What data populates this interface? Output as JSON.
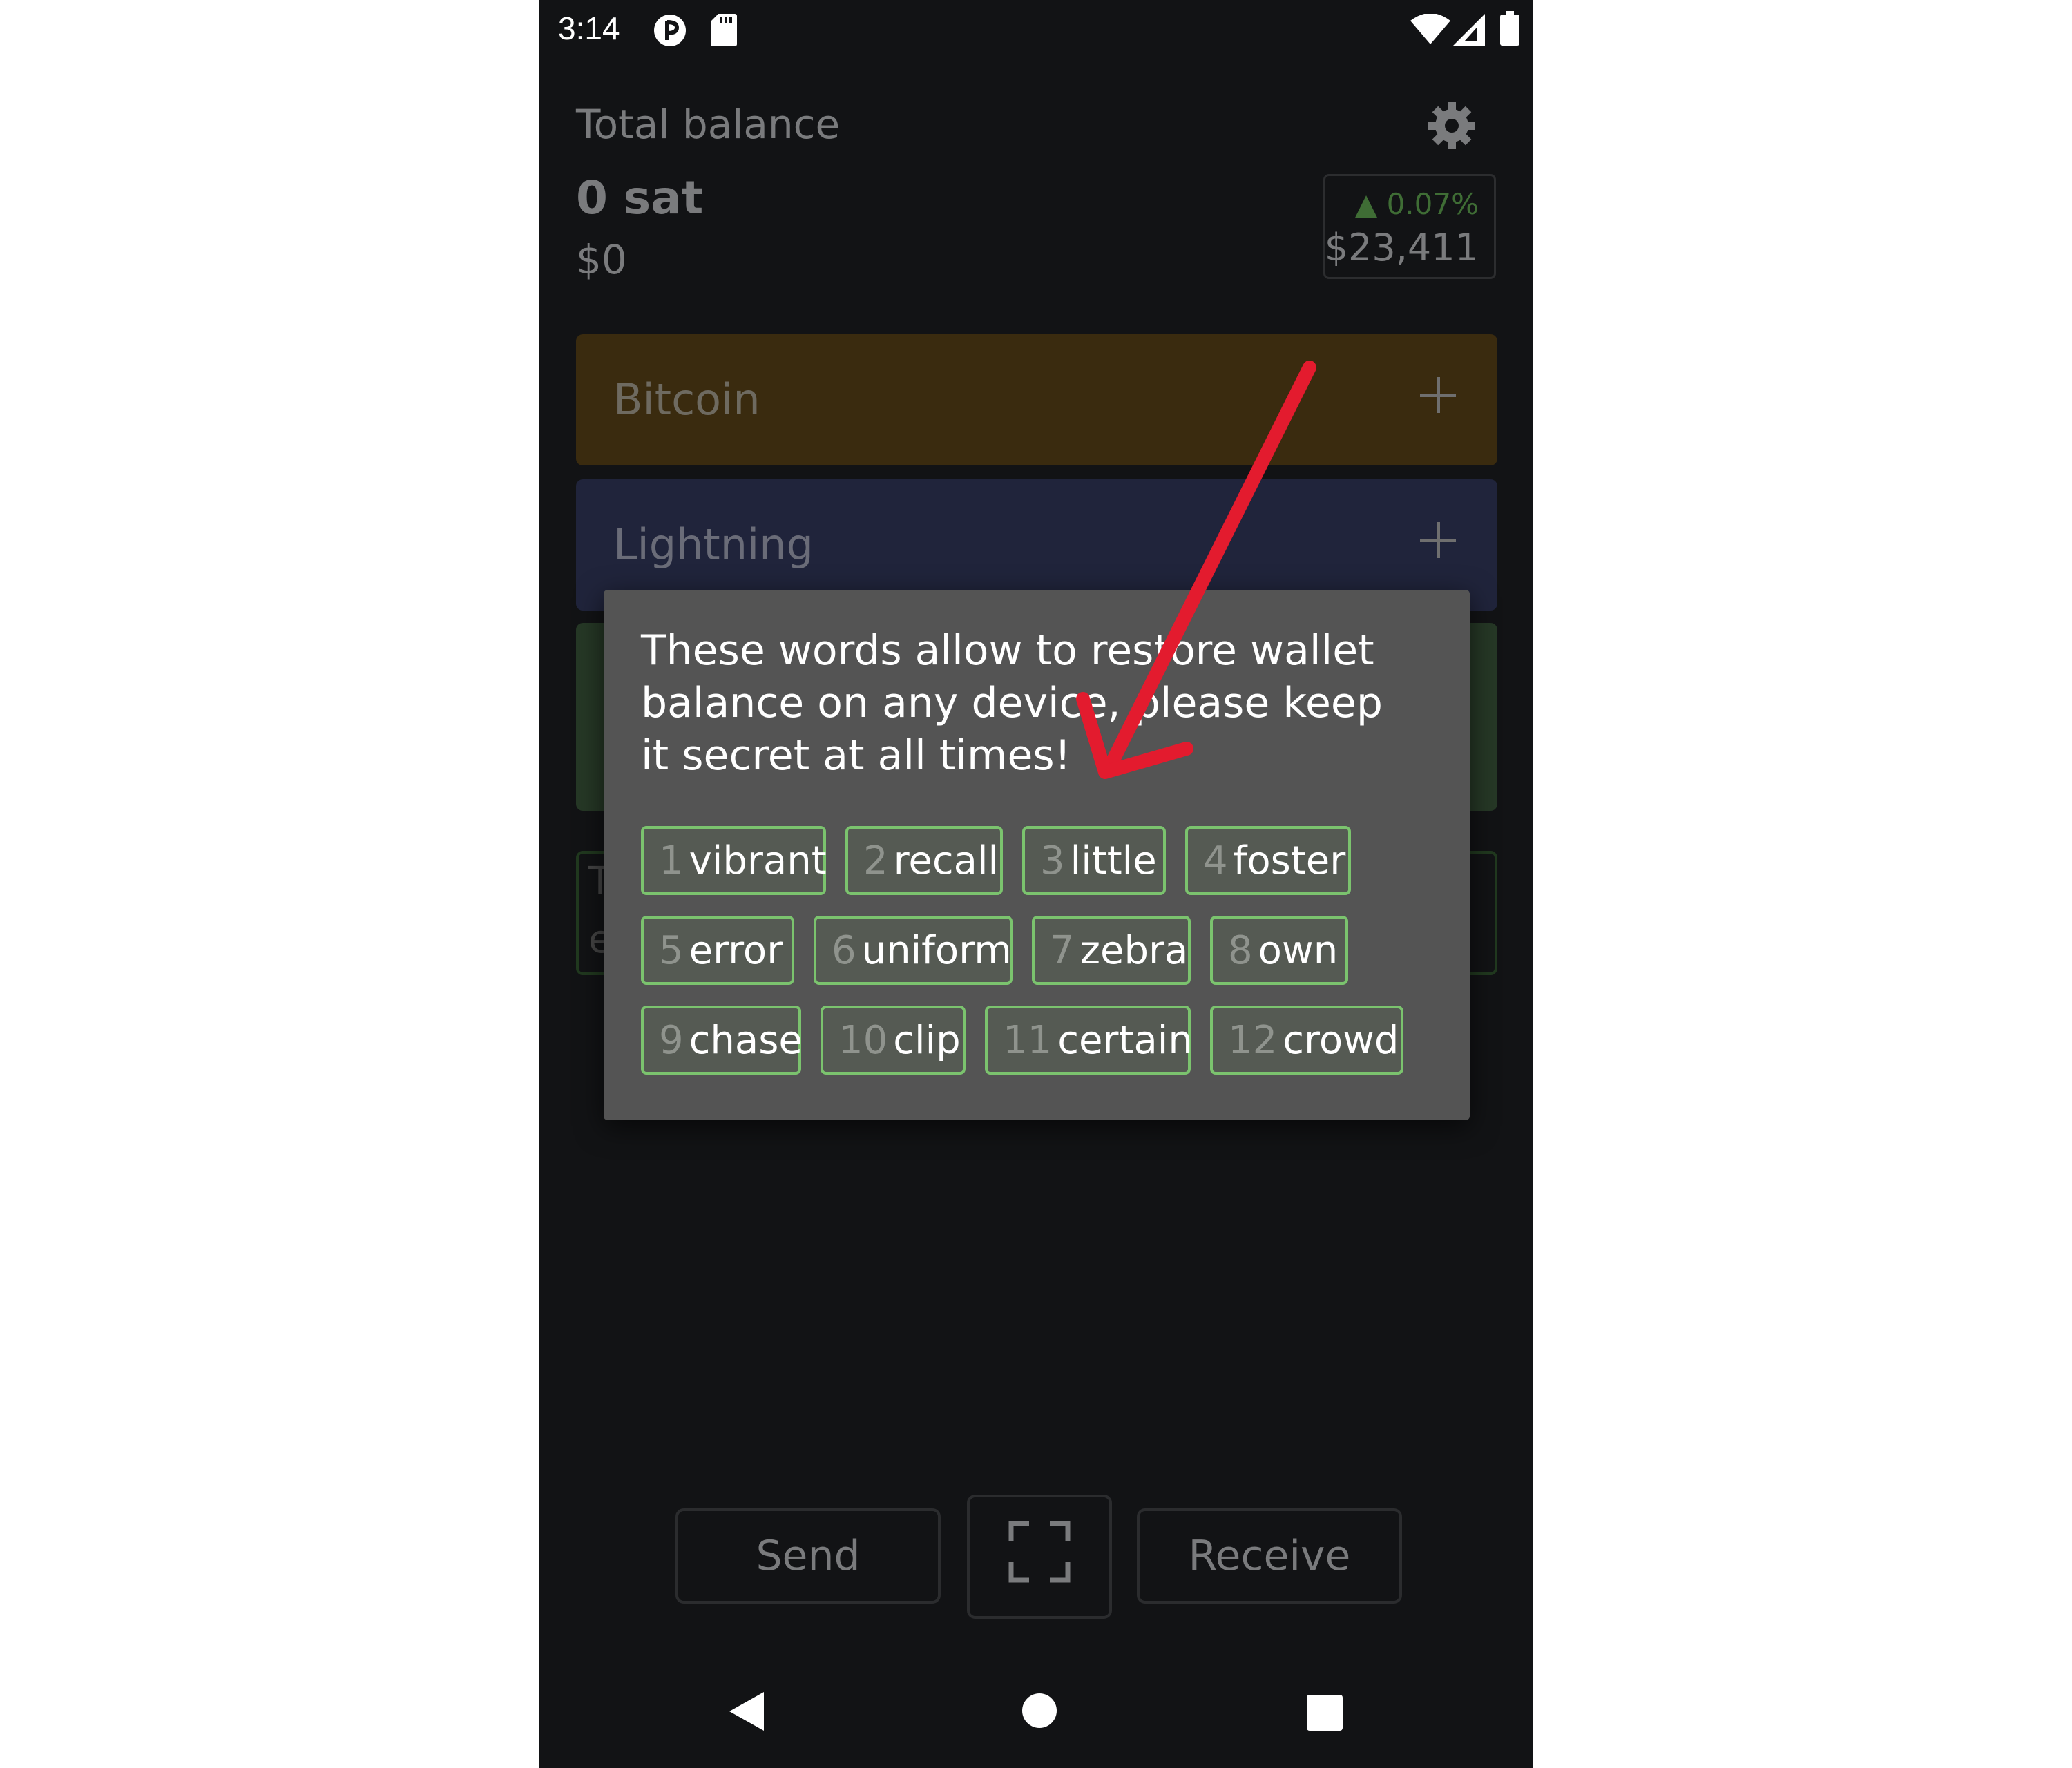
{
  "status_bar": {
    "time": "3:14",
    "icons": [
      "alarm-icon",
      "sd-card-icon",
      "wifi-icon",
      "signal-icon",
      "battery-icon"
    ]
  },
  "header": {
    "total_label": "Total balance",
    "sat_amount": "0 sat",
    "fiat_amount": "$0",
    "rate_change": "▲ 0.07%",
    "rate_price": "$23,411",
    "settings_icon": "gear-icon"
  },
  "cards": {
    "bitcoin": {
      "label": "Bitcoin",
      "color": "#3a2b0f"
    },
    "lightning": {
      "label": "Lightning",
      "color": "#20243b"
    },
    "green_color": "#263826",
    "outline_glyphs": [
      "T",
      "e"
    ]
  },
  "dialog": {
    "message": "These words allow to restore wallet balance on any device, please keep it secret at all times!",
    "words": [
      {
        "num": "1",
        "word": "vibrant"
      },
      {
        "num": "2",
        "word": "recall"
      },
      {
        "num": "3",
        "word": "little"
      },
      {
        "num": "4",
        "word": "foster"
      },
      {
        "num": "5",
        "word": "error"
      },
      {
        "num": "6",
        "word": "uniform"
      },
      {
        "num": "7",
        "word": "zebra"
      },
      {
        "num": "8",
        "word": "own"
      },
      {
        "num": "9",
        "word": "chase"
      },
      {
        "num": "10",
        "word": "clip"
      },
      {
        "num": "11",
        "word": "certain"
      },
      {
        "num": "12",
        "word": "crowd"
      }
    ],
    "chip_border_color": "#7bc36e"
  },
  "actions": {
    "send_label": "Send",
    "receive_label": "Receive",
    "scan_icon": "scan-qr-icon"
  },
  "nav": {
    "back_icon": "back-triangle-icon",
    "home_icon": "home-circle-icon",
    "recent_icon": "recent-square-icon"
  },
  "annotation": {
    "color": "#e31b2e",
    "icon": "red-arrow-annotation"
  }
}
